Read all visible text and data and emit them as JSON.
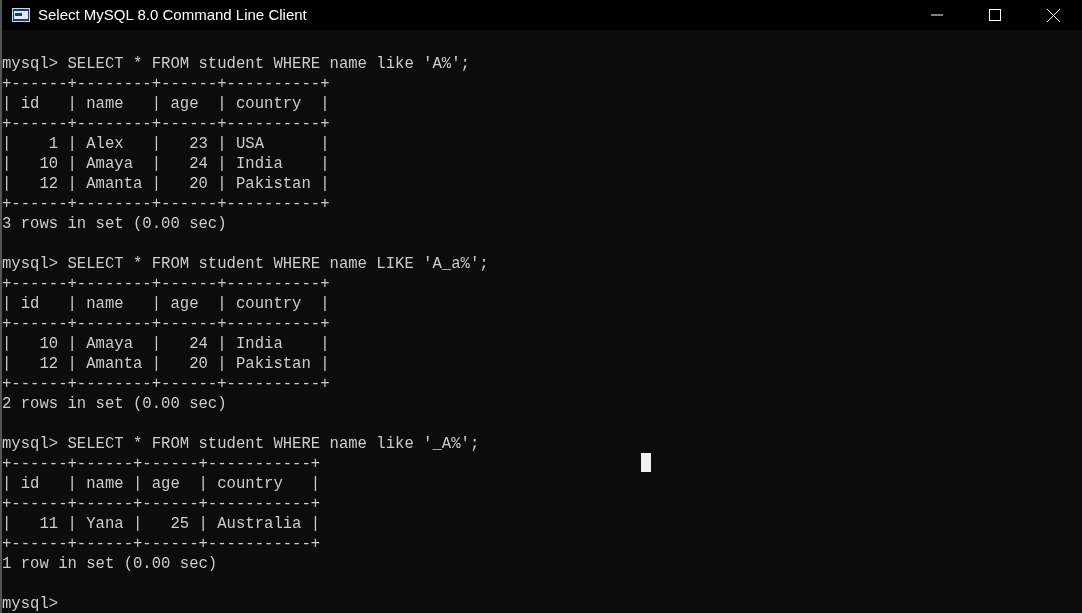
{
  "window": {
    "title": "Select MySQL 8.0 Command Line Client"
  },
  "console": {
    "blocks": [
      [
        "mysql> SELECT * FROM student WHERE name like 'A%';",
        "+------+--------+------+----------+",
        "| id   | name   | age  | country  |",
        "+------+--------+------+----------+",
        "|    1 | Alex   |   23 | USA      |",
        "|   10 | Amaya  |   24 | India    |",
        "|   12 | Amanta |   20 | Pakistan |",
        "+------+--------+------+----------+",
        "3 rows in set (0.00 sec)"
      ],
      [
        "mysql> SELECT * FROM student WHERE name LIKE 'A_a%';",
        "+------+--------+------+----------+",
        "| id   | name   | age  | country  |",
        "+------+--------+------+----------+",
        "|   10 | Amaya  |   24 | India    |",
        "|   12 | Amanta |   20 | Pakistan |",
        "+------+--------+------+----------+",
        "2 rows in set (0.00 sec)"
      ],
      [
        "mysql> SELECT * FROM student WHERE name like '_A%';",
        "+------+------+------+-----------+",
        "| id   | name | age  | country   |",
        "+------+------+------+-----------+",
        "|   11 | Yana |   25 | Australia |",
        "+------+------+------+-----------+",
        "1 row in set (0.00 sec)"
      ],
      [
        "mysql>"
      ]
    ]
  }
}
